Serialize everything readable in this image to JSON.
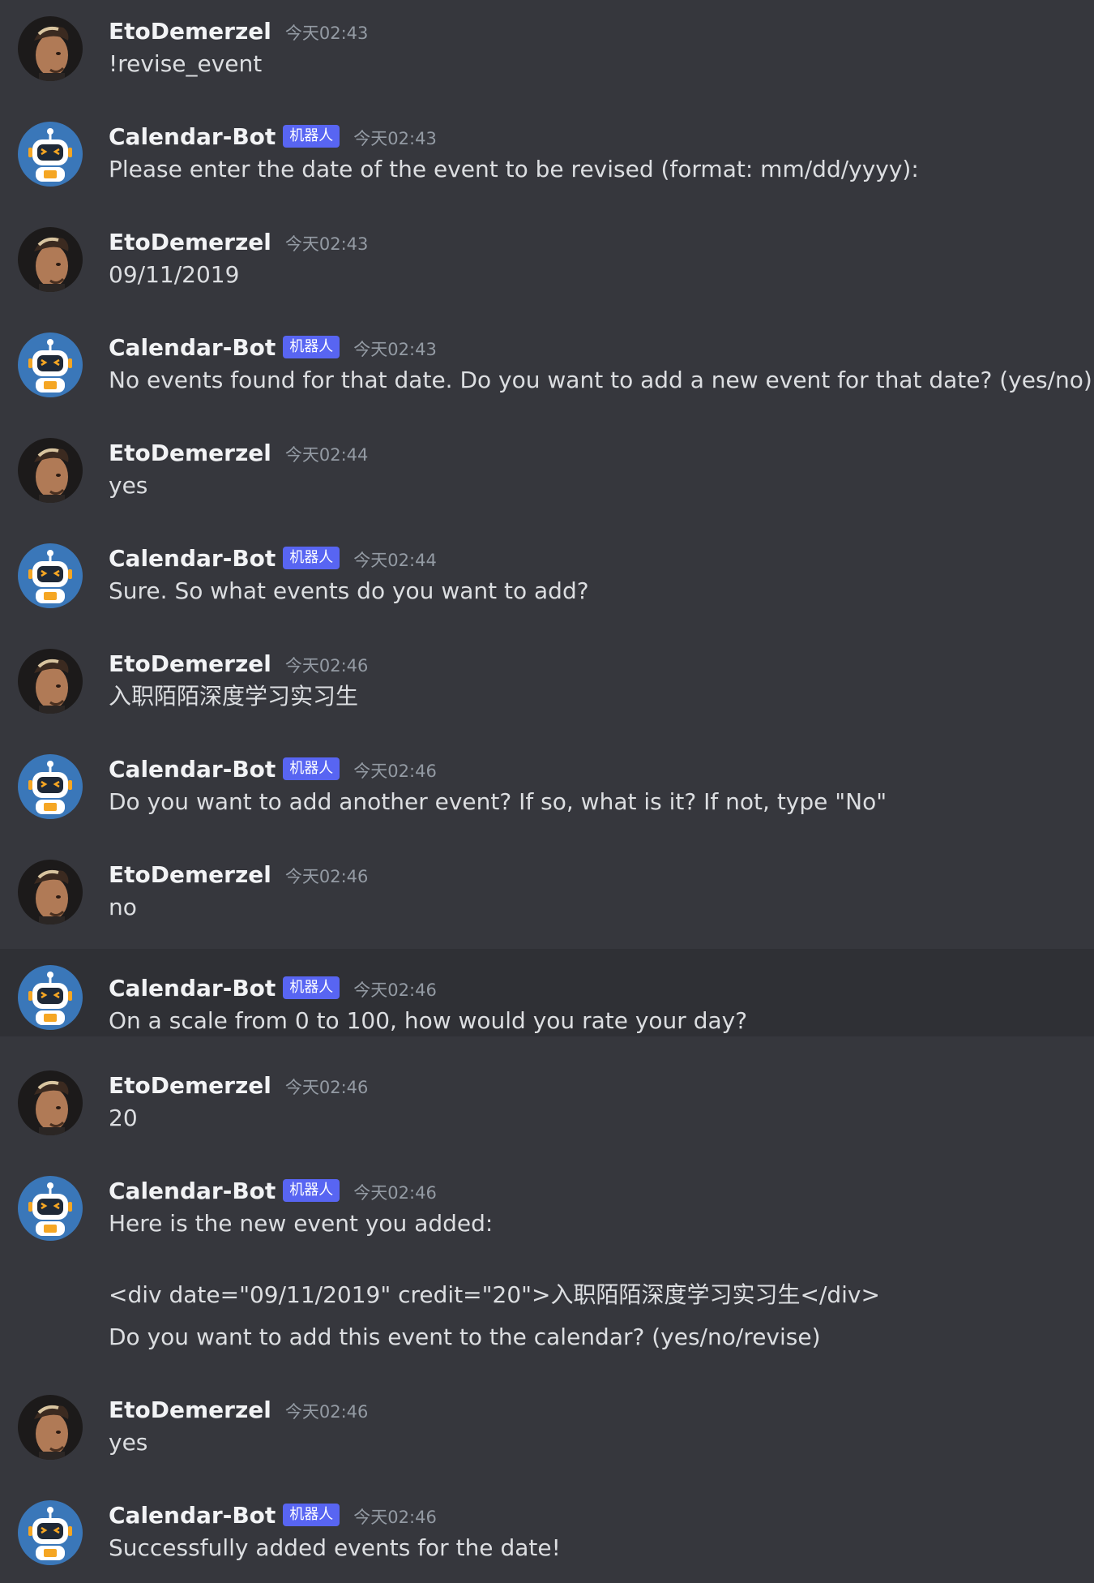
{
  "users": {
    "human": {
      "name": "EtoDemerzel"
    },
    "bot": {
      "name": "Calendar-Bot",
      "tag": "机器人"
    }
  },
  "colors": {
    "background": "#36373d",
    "highlight_row": "#2f3035",
    "bot_tag": "#5865f2",
    "bot_avatar": "#3a77b9",
    "username": "#f2f3f5",
    "text": "#dcdee1",
    "timestamp": "#949ba4"
  },
  "messages": [
    {
      "author": "EtoDemerzel",
      "bot": false,
      "time": "今天02:43",
      "lines": [
        "!revise_event"
      ]
    },
    {
      "author": "Calendar-Bot",
      "bot": true,
      "time": "今天02:43",
      "lines": [
        "Please enter the date of the event to be revised (format: mm/dd/yyyy):"
      ]
    },
    {
      "author": "EtoDemerzel",
      "bot": false,
      "time": "今天02:43",
      "lines": [
        "09/11/2019"
      ]
    },
    {
      "author": "Calendar-Bot",
      "bot": true,
      "time": "今天02:43",
      "lines": [
        "No events found for that date. Do you want to add a new event for that date? (yes/no)"
      ]
    },
    {
      "author": "EtoDemerzel",
      "bot": false,
      "time": "今天02:44",
      "lines": [
        "yes"
      ]
    },
    {
      "author": "Calendar-Bot",
      "bot": true,
      "time": "今天02:44",
      "lines": [
        "Sure. So what events do you want to add?"
      ]
    },
    {
      "author": "EtoDemerzel",
      "bot": false,
      "time": "今天02:46",
      "lines": [
        "入职陌陌深度学习实习生"
      ]
    },
    {
      "author": "Calendar-Bot",
      "bot": true,
      "time": "今天02:46",
      "lines": [
        "Do you want to add another event? If so, what is it? If not, type \"No\""
      ]
    },
    {
      "author": "EtoDemerzel",
      "bot": false,
      "time": "今天02:46",
      "lines": [
        "no"
      ]
    },
    {
      "author": "Calendar-Bot",
      "bot": true,
      "time": "今天02:46",
      "highlight": true,
      "lines": [
        "On a scale from 0 to 100, how would you rate your day?"
      ]
    },
    {
      "author": "EtoDemerzel",
      "bot": false,
      "time": "今天02:46",
      "lines": [
        "20"
      ]
    },
    {
      "author": "Calendar-Bot",
      "bot": true,
      "time": "今天02:46",
      "multi": true,
      "lines": [
        "Here is the new event you added:",
        "<div date=\"09/11/2019\" credit=\"20\">入职陌陌深度学习实习生</div>",
        "Do you want to add this event to the calendar? (yes/no/revise)"
      ]
    },
    {
      "author": "EtoDemerzel",
      "bot": false,
      "time": "今天02:46",
      "lines": [
        "yes"
      ]
    },
    {
      "author": "Calendar-Bot",
      "bot": true,
      "time": "今天02:46",
      "lines": [
        "Successfully added events for the date!"
      ]
    }
  ]
}
